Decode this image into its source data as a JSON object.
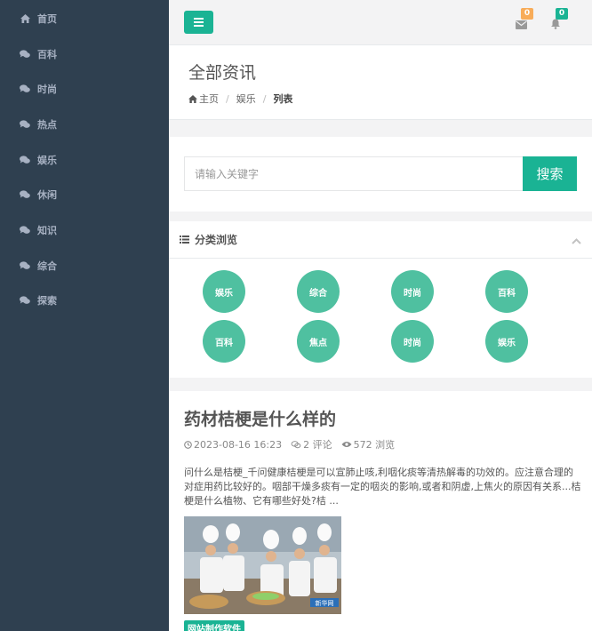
{
  "sidebar": {
    "items": [
      {
        "label": "首页",
        "icon": "home-icon"
      },
      {
        "label": "百科",
        "icon": "comments-icon"
      },
      {
        "label": "时尚",
        "icon": "comments-icon"
      },
      {
        "label": "热点",
        "icon": "comments-icon"
      },
      {
        "label": "娱乐",
        "icon": "comments-icon"
      },
      {
        "label": "休闲",
        "icon": "comments-icon"
      },
      {
        "label": "知识",
        "icon": "comments-icon"
      },
      {
        "label": "综合",
        "icon": "comments-icon"
      },
      {
        "label": "探索",
        "icon": "comments-icon"
      }
    ]
  },
  "topbar": {
    "mail_count": "0",
    "bell_count": "0",
    "mail_badge_color": "#f8ac59",
    "bell_badge_color": "#1ab394"
  },
  "header": {
    "title": "全部资讯",
    "breadcrumb": [
      "主页",
      "娱乐",
      "列表"
    ]
  },
  "search": {
    "placeholder": "请输入关键字",
    "button_label": "搜索"
  },
  "categories": {
    "title": "分类浏览",
    "items": [
      "娱乐",
      "综合",
      "时尚",
      "百科",
      "百科",
      "焦点",
      "时尚",
      "娱乐"
    ]
  },
  "article": {
    "title": "药材桔梗是什么样的",
    "datetime": "2023-08-16 16:23",
    "comments": "2 评论",
    "views": "572 浏览",
    "excerpt": "问什么是桔梗_千问健康桔梗是可以宣肺止咳,利咽化痰等清热解毒的功效的。应注意合理的对症用药比较好的。咽部干燥多痰有一定的咽炎的影响,或者和阴虚,上焦火的原因有关系...桔梗是什么植物、它有哪些好处?桔 ...",
    "image_caption": "新华网",
    "tag": "网站制作软件"
  },
  "colors": {
    "sidebar_bg": "#2f4050",
    "accent": "#1ab394",
    "circle": "#4fc0a0"
  }
}
